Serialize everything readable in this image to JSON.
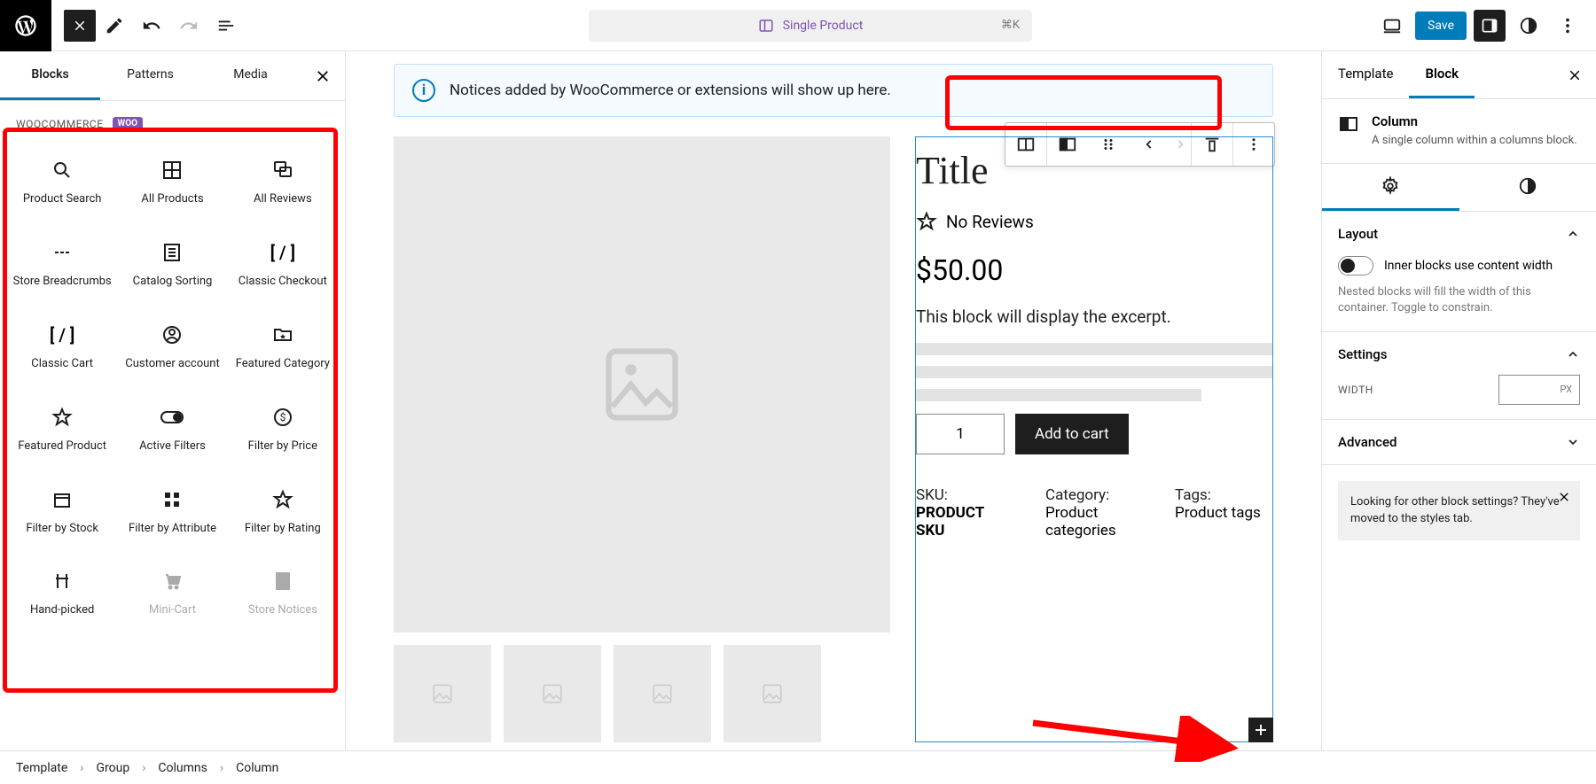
{
  "topbar": {
    "title": "Single Product",
    "shortcut": "⌘K",
    "save": "Save"
  },
  "inserter": {
    "tabs": [
      "Blocks",
      "Patterns",
      "Media"
    ],
    "category": "WOOCOMMERCE",
    "badge": "WOO",
    "blocks": [
      {
        "name": "product-search",
        "label": "Product Search"
      },
      {
        "name": "all-products",
        "label": "All Products"
      },
      {
        "name": "all-reviews",
        "label": "All Reviews"
      },
      {
        "name": "store-breadcrumbs",
        "label": "Store Breadcrumbs"
      },
      {
        "name": "catalog-sorting",
        "label": "Catalog Sorting"
      },
      {
        "name": "classic-checkout",
        "label": "Classic Checkout"
      },
      {
        "name": "classic-cart",
        "label": "Classic Cart"
      },
      {
        "name": "customer-account",
        "label": "Customer account"
      },
      {
        "name": "featured-category",
        "label": "Featured Category"
      },
      {
        "name": "featured-product",
        "label": "Featured Product"
      },
      {
        "name": "active-filters",
        "label": "Active Filters"
      },
      {
        "name": "filter-price",
        "label": "Filter by Price"
      },
      {
        "name": "filter-stock",
        "label": "Filter by Stock"
      },
      {
        "name": "filter-attribute",
        "label": "Filter by Attribute"
      },
      {
        "name": "filter-rating",
        "label": "Filter by Rating"
      },
      {
        "name": "hand-picked",
        "label": "Hand-picked"
      },
      {
        "name": "mini-cart",
        "label": "Mini-Cart"
      },
      {
        "name": "store-notices",
        "label": "Store Notices"
      }
    ]
  },
  "canvas": {
    "notice": "Notices added by WooCommerce or extensions will show up here.",
    "title": "Title",
    "no_reviews": "No Reviews",
    "price": "$50.00",
    "excerpt": "This block will display the excerpt.",
    "qty": "1",
    "add_to_cart": "Add to cart",
    "meta": {
      "sku_l": "SKU:",
      "sku_v": "PRODUCT SKU",
      "cat_l": "Category:",
      "cat_v": "Product categories",
      "tag_l": "Tags:",
      "tag_v": "Product tags"
    }
  },
  "rsidebar": {
    "tabs": [
      "Template",
      "Block"
    ],
    "block_title": "Column",
    "block_desc": "A single column within a columns block.",
    "panels": {
      "layout": "Layout",
      "layout_toggle": "Inner blocks use content width",
      "layout_help": "Nested blocks will fill the width of this container. Toggle to constrain.",
      "settings": "Settings",
      "width_label": "WIDTH",
      "width_unit": "PX",
      "advanced": "Advanced"
    },
    "hint": "Looking for other block settings? They've moved to the styles tab."
  },
  "breadcrumb": [
    "Template",
    "Group",
    "Columns",
    "Column"
  ]
}
